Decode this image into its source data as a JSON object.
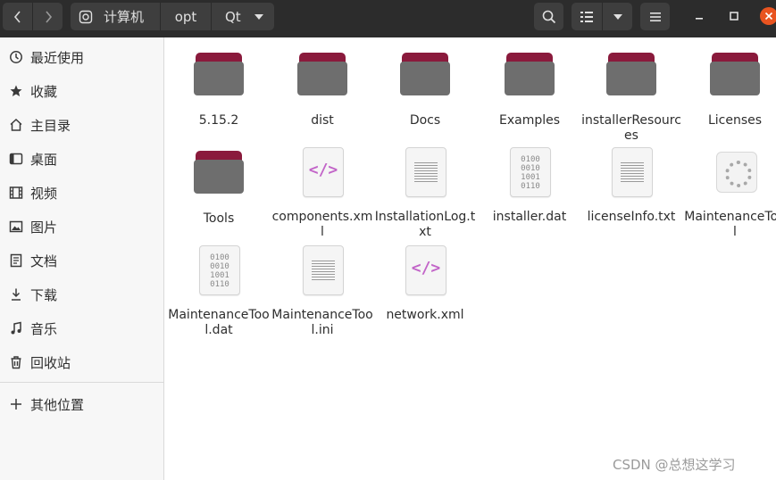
{
  "header": {
    "back_icon": "chevron-left-icon",
    "forward_icon": "chevron-right-icon",
    "location_icon": "drive-icon",
    "path": [
      "计算机",
      "opt",
      "Qt"
    ],
    "path_menu_icon": "triangle-down-icon",
    "search_icon": "search-icon",
    "view_icon": "list-view-icon",
    "view_menu_icon": "triangle-down-icon",
    "menu_icon": "hamburger-icon",
    "window_controls": [
      "minimize-icon",
      "maximize-icon",
      "close-icon"
    ],
    "close_color": "#e95420"
  },
  "sidebar": {
    "items": [
      {
        "label": "最近使用",
        "icon": "clock-icon"
      },
      {
        "label": "收藏",
        "icon": "star-icon"
      },
      {
        "label": "主目录",
        "icon": "home-icon"
      },
      {
        "label": "桌面",
        "icon": "desktop-icon"
      },
      {
        "label": "视频",
        "icon": "film-icon"
      },
      {
        "label": "图片",
        "icon": "image-icon"
      },
      {
        "label": "文档",
        "icon": "document-icon"
      },
      {
        "label": "下载",
        "icon": "download-icon"
      },
      {
        "label": "音乐",
        "icon": "music-icon"
      },
      {
        "label": "回收站",
        "icon": "trash-icon"
      }
    ],
    "other_locations": {
      "label": "其他位置",
      "icon": "plus-icon"
    }
  },
  "files": [
    {
      "name": "5.15.2",
      "type": "folder"
    },
    {
      "name": "dist",
      "type": "folder"
    },
    {
      "name": "Docs",
      "type": "folder"
    },
    {
      "name": "Examples",
      "type": "folder"
    },
    {
      "name": "installerResources",
      "type": "folder"
    },
    {
      "name": "Licenses",
      "type": "folder"
    },
    {
      "name": "Tools",
      "type": "folder"
    },
    {
      "name": "components.xml",
      "type": "xml"
    },
    {
      "name": "InstallationLog.txt",
      "type": "text"
    },
    {
      "name": "installer.dat",
      "type": "binary"
    },
    {
      "name": "licenseInfo.txt",
      "type": "text"
    },
    {
      "name": "MaintenanceTool",
      "type": "executable"
    },
    {
      "name": "MaintenanceTool.dat",
      "type": "binary"
    },
    {
      "name": "MaintenanceTool.ini",
      "type": "text"
    },
    {
      "name": "network.xml",
      "type": "xml"
    }
  ],
  "colors": {
    "folder_tab": "#8a1a3c",
    "folder_body": "#6e6e6e",
    "xml_mark": "#c264c8"
  },
  "watermark": "CSDN @总想这学习"
}
